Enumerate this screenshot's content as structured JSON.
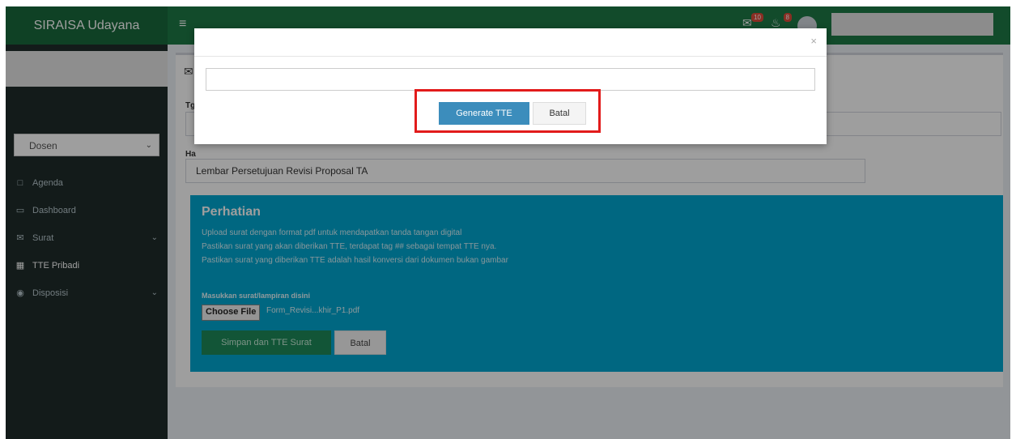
{
  "app": {
    "brand": "SIRAISA Udayana"
  },
  "header": {
    "menu_icon": "hamburger-icon",
    "mail_badge": "10",
    "bell_badge": "8"
  },
  "sidebar": {
    "role_value": "Dosen",
    "items": [
      {
        "label": "Agenda",
        "icon": "calendar-icon"
      },
      {
        "label": "Dashboard",
        "icon": "monitor-icon"
      },
      {
        "label": "Surat",
        "icon": "envelope-icon"
      },
      {
        "label": "TTE Pribadi",
        "icon": "calendar-icon"
      },
      {
        "label": "Disposisi",
        "icon": "eye-icon"
      }
    ]
  },
  "form": {
    "label_top": "Tg",
    "label_hal": "Ha",
    "hal_value": "Lembar Persetujuan Revisi Proposal TA"
  },
  "callout": {
    "title": "Perhatian",
    "line1": "Upload surat dengan format pdf untuk mendapatkan tanda tangan digital",
    "line2": "Pastikan surat yang akan diberikan TTE, terdapat tag ## sebagai tempat TTE nya.",
    "line3": "Pastikan surat yang diberikan TTE adalah hasil konversi dari dokumen bukan gambar",
    "upload_label": "Masukkan surat/lampiran disini",
    "choose_file": "Choose File",
    "file_name": "Form_Revisi...khir_P1.pdf",
    "save_button": "Simpan dan TTE Surat",
    "cancel_button": "Batal"
  },
  "modal": {
    "close": "×",
    "generate_button": "Generate TTE",
    "cancel_button": "Batal"
  },
  "colors": {
    "header": "#1e7a46",
    "callout": "#00a7d0",
    "primary": "#3c8dbc",
    "highlight": "#e21b1b"
  }
}
